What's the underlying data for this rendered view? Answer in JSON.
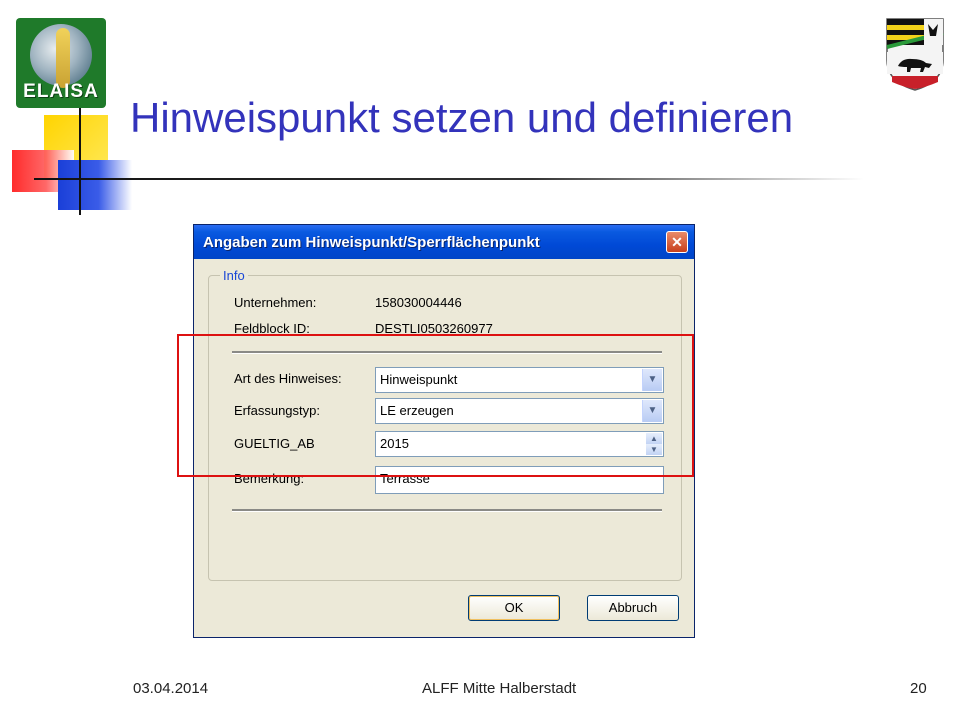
{
  "slide": {
    "title": "Hinweispunkt setzen und definieren",
    "logo_text": "ELAISA"
  },
  "dialog": {
    "title": "Angaben zum Hinweispunkt/Sperrflächenpunkt",
    "close_symbol": "✕",
    "group_label": "Info",
    "info": {
      "unternehmen_label": "Unternehmen:",
      "unternehmen_value": "158030004446",
      "feldblock_label": "Feldblock ID:",
      "feldblock_value": "DESTLI0503260977"
    },
    "fields": {
      "art_label": "Art des Hinweises:",
      "art_value": "Hinweispunkt",
      "erfassung_label": "Erfassungstyp:",
      "erfassung_value": "LE erzeugen",
      "gueltig_label": "GUELTIG_AB",
      "gueltig_value": "2015",
      "bemerkung_label": "Bemerkung:",
      "bemerkung_value": "Terrasse"
    },
    "buttons": {
      "ok": "OK",
      "cancel": "Abbruch"
    }
  },
  "footer": {
    "date": "03.04.2014",
    "org": "ALFF Mitte Halberstadt",
    "page": "20"
  },
  "icons": {
    "dropdown": "chevron-down-icon",
    "spin_up": "arrow-up-icon",
    "spin_down": "arrow-down-icon",
    "close": "close-icon"
  },
  "colors": {
    "title": "#3333bb",
    "titlebar": "#0049d6",
    "highlight": "#dd1111"
  }
}
